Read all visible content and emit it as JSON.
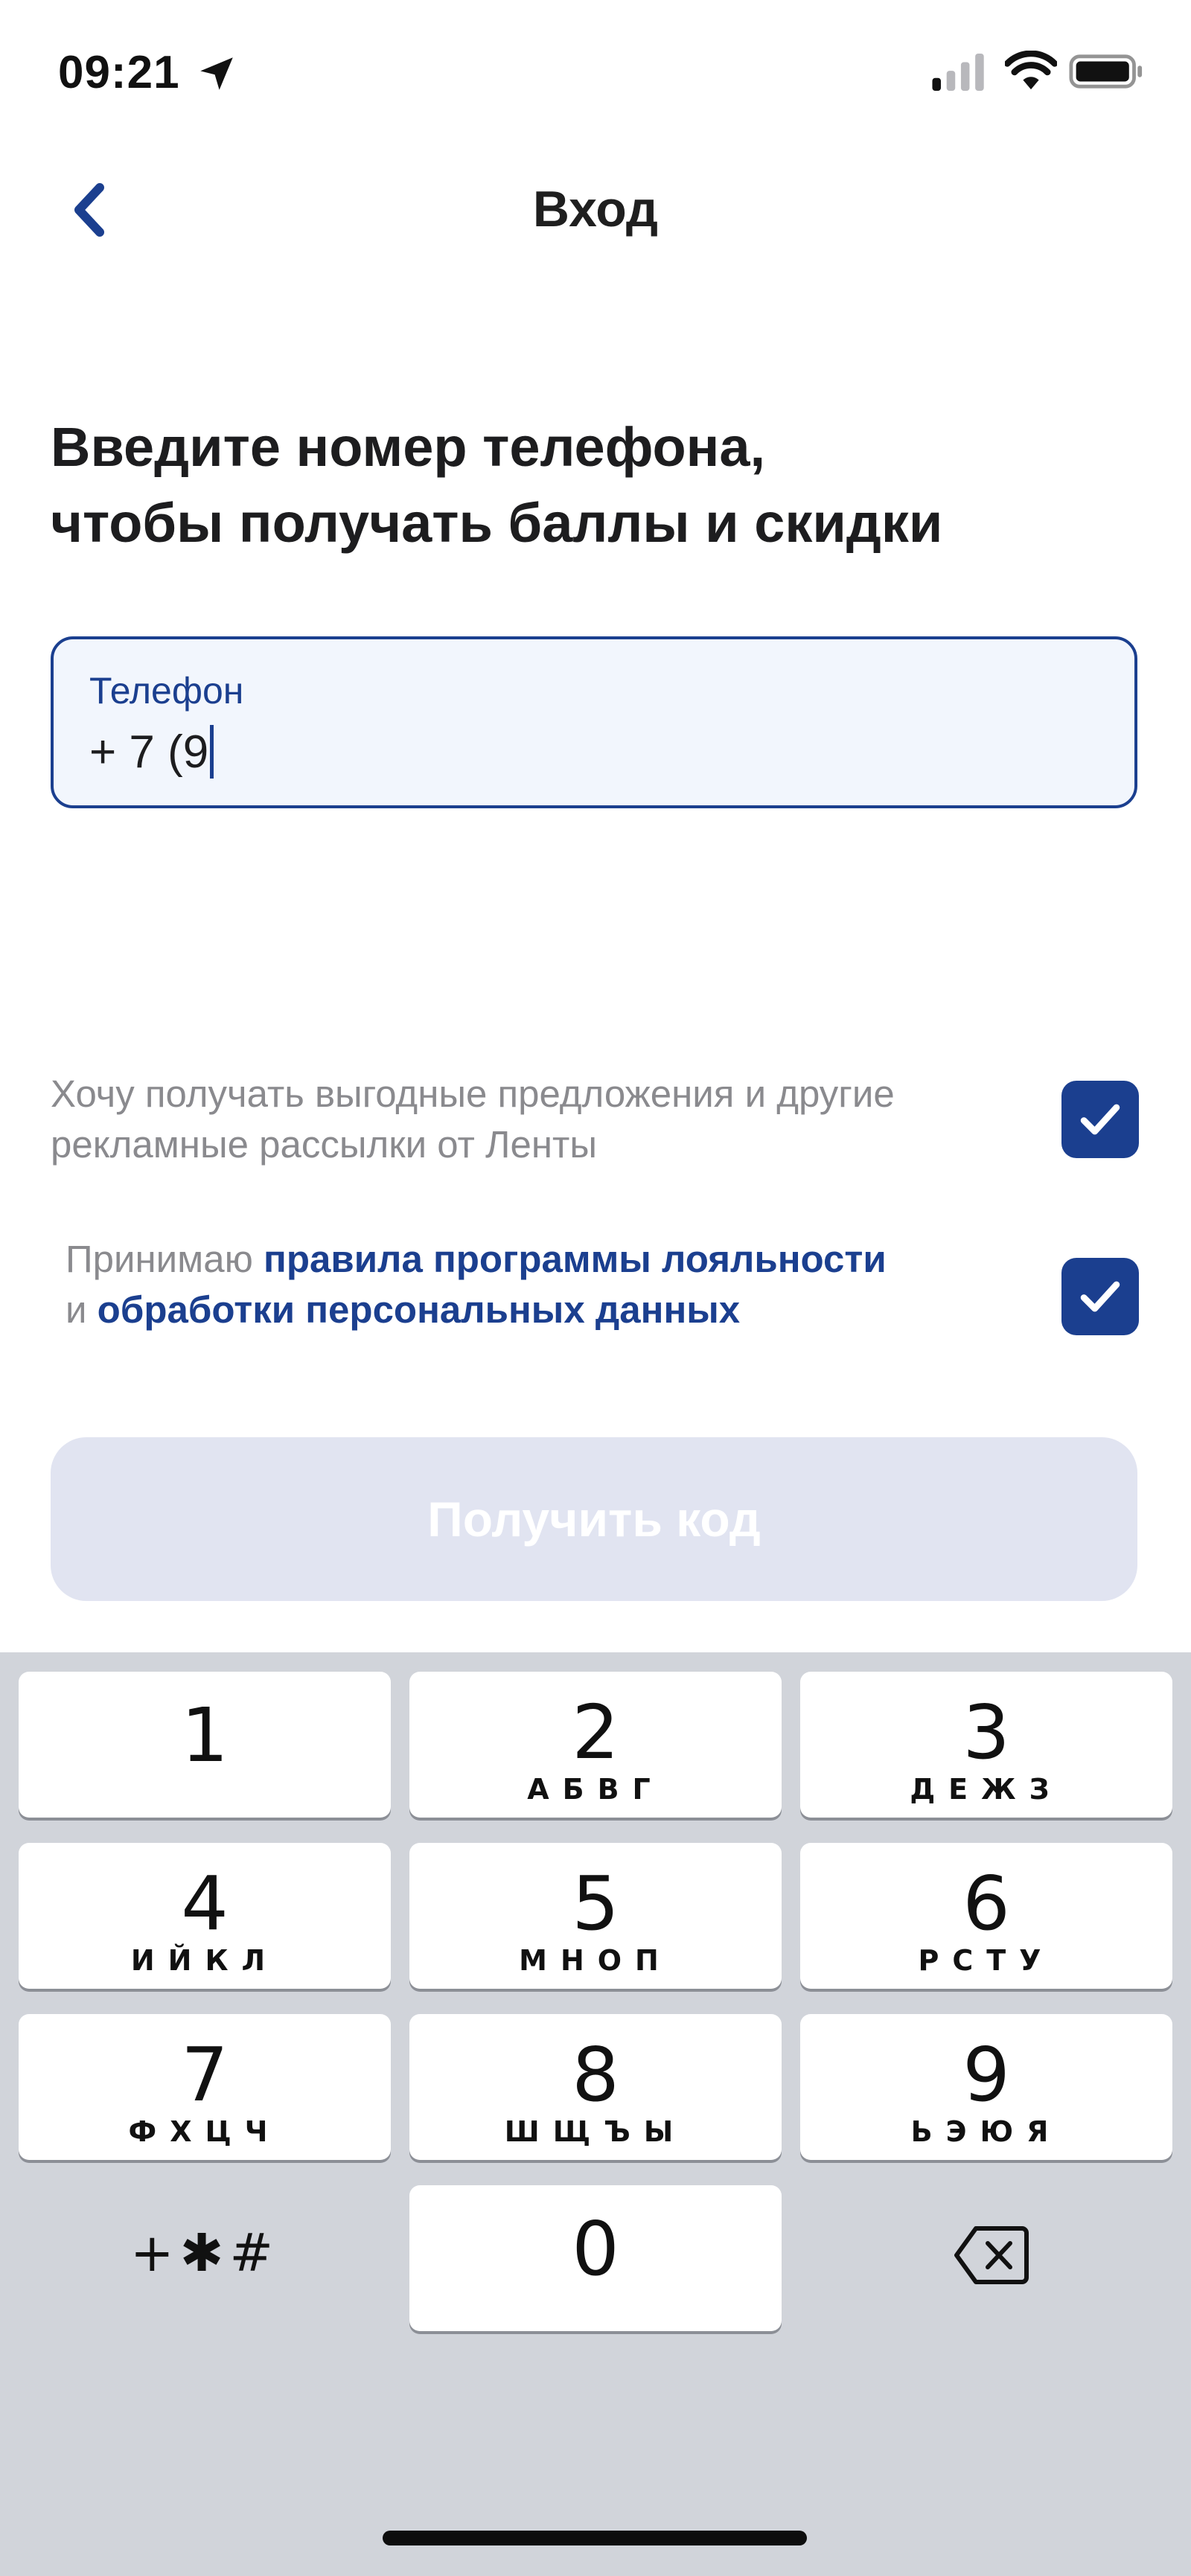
{
  "status_bar": {
    "time": "09:21",
    "icons": [
      "location-arrow-icon",
      "cellular-signal-icon",
      "wifi-icon",
      "battery-icon"
    ]
  },
  "nav": {
    "back_icon": "chevron-left-icon",
    "title": "Вход"
  },
  "heading": {
    "line1": "Введите номер телефона,",
    "line2": "чтобы получать баллы и скидки"
  },
  "phone_field": {
    "label": "Телефон",
    "value": "+ 7 (9"
  },
  "consents": {
    "ads": {
      "line1": "Хочу получать выгодные предложения и другие",
      "line2": "рекламные рассылки от Ленты",
      "checked": true
    },
    "rules": {
      "prefix": "Принимаю ",
      "link1": "правила программы лояльности",
      "joiner": "и ",
      "link2": "обработки персональных данных",
      "checked": true
    }
  },
  "submit": {
    "label": "Получить код",
    "enabled": false
  },
  "keyboard": {
    "keys": [
      {
        "digit": "1",
        "letters": ""
      },
      {
        "digit": "2",
        "letters": "АБВГ"
      },
      {
        "digit": "3",
        "letters": "ДЕЖЗ"
      },
      {
        "digit": "4",
        "letters": "ИЙКЛ"
      },
      {
        "digit": "5",
        "letters": "МНОП"
      },
      {
        "digit": "6",
        "letters": "РСТУ"
      },
      {
        "digit": "7",
        "letters": "ФХЦЧ"
      },
      {
        "digit": "8",
        "letters": "ШЩЪЫ"
      },
      {
        "digit": "9",
        "letters": "ЬЭЮЯ"
      },
      {
        "digit": "0",
        "letters": ""
      }
    ],
    "symbols_label": "+✱#",
    "delete_icon": "backspace-icon"
  },
  "colors": {
    "accent": "#1b3f8f",
    "field_background": "#f2f6fd",
    "button_disabled": "#e1e4f1",
    "keyboard_background": "#d1d4da",
    "muted_text": "#8a8a8e"
  }
}
